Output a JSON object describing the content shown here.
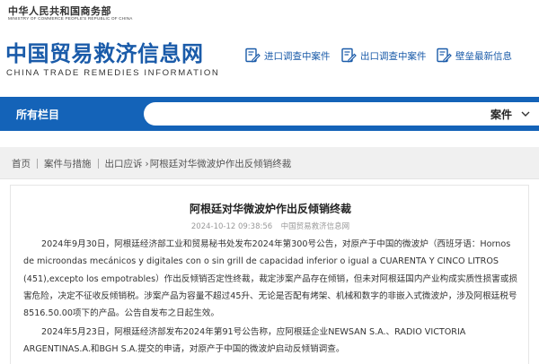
{
  "header": {
    "ministry_cn": "中华人民共和国商务部",
    "ministry_en": "MINISTRY OF COMMERCE PEOPLE'S REPUBLIC OF CHINA",
    "site_title": "中国贸易救济信息网",
    "site_title_en": "CHINA TRADE REMEDIES INFORMATION",
    "quick_links": [
      {
        "label": "进口调查中案件",
        "icon": "document-edit-icon"
      },
      {
        "label": "出口调查中案件",
        "icon": "document-edit-icon"
      },
      {
        "label": "壁垒最新信息",
        "icon": "document-edit-icon"
      }
    ]
  },
  "nav": {
    "all_columns": "所有栏目",
    "search_category": "案件"
  },
  "breadcrumb": {
    "items": [
      "首页",
      "案件与措施",
      "出口应诉"
    ],
    "current": "阿根廷对华微波炉作出反倾销终裁"
  },
  "article": {
    "title": "阿根廷对华微波炉作出反倾销终裁",
    "date": "2024-10-12 09:38:56",
    "source": "中国贸易救济信息网",
    "paragraph_1": "2024年9月30日，阿根廷经济部工业和贸易秘书处发布2024年第300号公告，对原产于中国的微波炉（西班牙语：Hornos de microondas mecánicos y digitales con o sin grill de capacidad inferior o igual a CUARENTA Y CINCO LITROS (451),excepto los empotrables）作出反倾销否定性终裁，裁定涉案产品存在倾销，但未对阿根廷国内产业构成实质性损害或损害危险，决定不征收反倾销税。涉案产品为容量不超过45升、无论是否配有烤架、机械和数字的非嵌入式微波炉，涉及阿根廷税号8516.50.00项下的产品。公告自发布之日起生效。",
    "paragraph_2": "2024年5月23日，阿根廷经济部发布2024年第91号公告称，应阿根廷企业NEWSAN S.A.、RADIO VICTORIA ARGENTINAS.A.和BGH S.A.提交的申请，对原产于中国的微波炉启动反倾销调查。"
  },
  "colors": {
    "brand_blue": "#1a5ba9",
    "nav_blue": "#1463b8",
    "breadcrumb_bg": "#f0f0f0"
  }
}
